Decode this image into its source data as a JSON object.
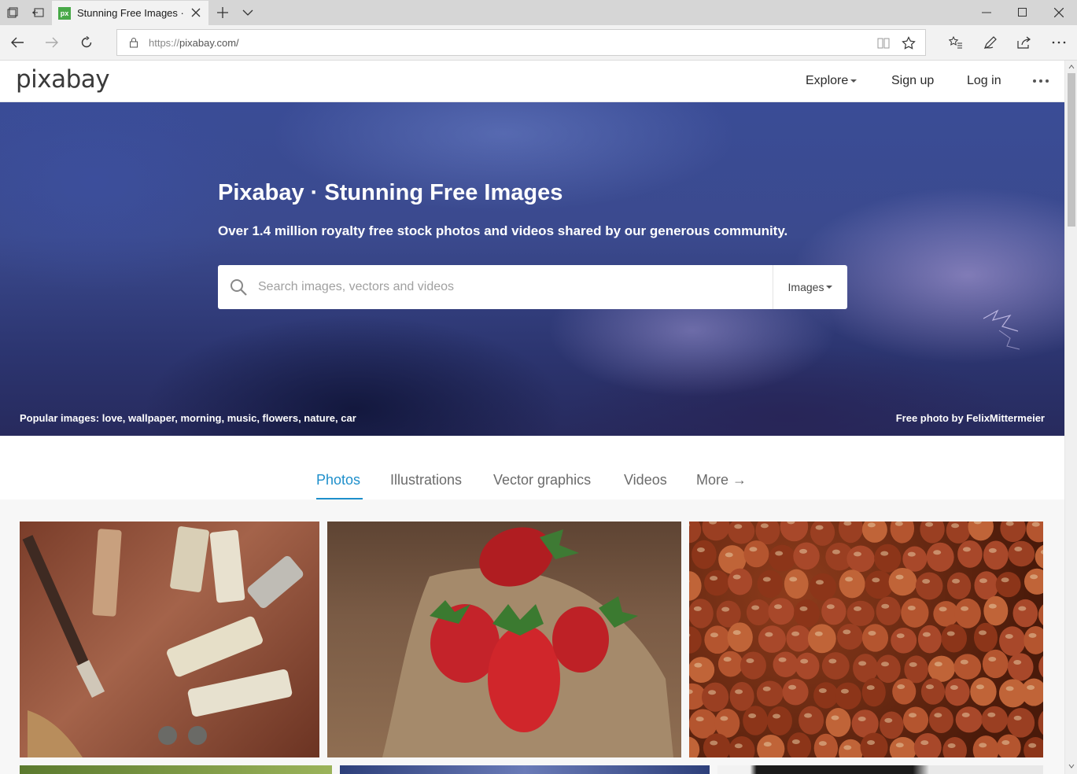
{
  "browser": {
    "tab_title": "Stunning Free Images ·",
    "tab_favicon": "px",
    "url_scheme": "https://",
    "url_host": "pixabay.com/"
  },
  "header": {
    "logo": "pixabay",
    "nav": {
      "explore": "Explore",
      "signup": "Sign up",
      "login": "Log in"
    }
  },
  "hero": {
    "title": "Pixabay · Stunning Free Images",
    "subtitle": "Over 1.4 million royalty free stock photos and videos shared by our generous community.",
    "search_placeholder": "Search images, vectors and videos",
    "search_type": "Images",
    "popular_label": "Popular images:",
    "popular_terms": [
      "love",
      "wallpaper",
      "morning",
      "music",
      "flowers",
      "nature",
      "car"
    ],
    "credit": "Free photo by FelixMittermeier"
  },
  "media_tabs": [
    "Photos",
    "Illustrations",
    "Vector graphics",
    "Videos",
    "More →"
  ],
  "colors": {
    "accent": "#1e8fcb",
    "hero_dark": "#2c3570"
  },
  "icons": [
    "back-icon",
    "forward-icon",
    "refresh-icon",
    "lock-icon",
    "reading-view-icon",
    "favorite-star-icon",
    "favorites-hub-icon",
    "pen-icon",
    "share-icon",
    "more-icon",
    "search-icon"
  ]
}
